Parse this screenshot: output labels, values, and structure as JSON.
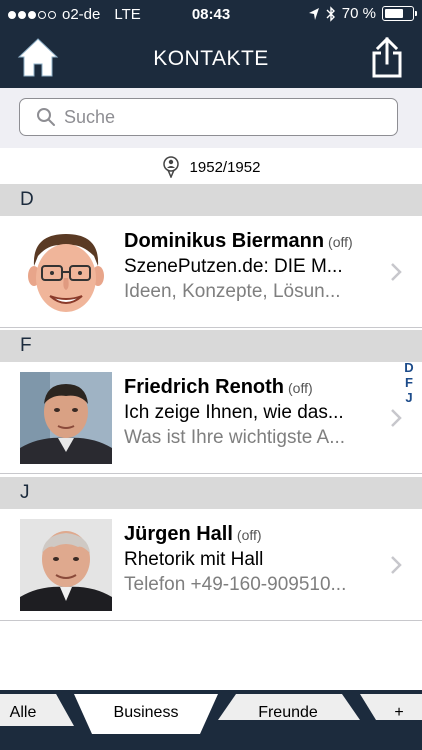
{
  "status_bar": {
    "carrier": "o2-de",
    "network": "LTE",
    "time": "08:43",
    "battery": "70 %",
    "battery_level": 0.7,
    "signal_bars_filled": 3,
    "signal_bars_total": 5
  },
  "nav": {
    "title": "KONTAKTE"
  },
  "search": {
    "placeholder": "Suche"
  },
  "contact_count": "1952/1952",
  "sections": [
    {
      "letter": "D",
      "contacts": [
        {
          "name": "Dominikus Biermann",
          "status": "(off)",
          "line2": "SzenePutzen.de: DIE M...",
          "line3": "Ideen, Konzepte, Lösun..."
        }
      ]
    },
    {
      "letter": "F",
      "contacts": [
        {
          "name": "Friedrich Renoth",
          "status": "(off)",
          "line2": "Ich zeige Ihnen, wie das...",
          "line3": "Was ist Ihre wichtigste A..."
        }
      ]
    },
    {
      "letter": "J",
      "contacts": [
        {
          "name": "Jürgen Hall",
          "status": "(off)",
          "line2": "Rhetorik mit Hall",
          "line3": "Telefon +49-160-909510..."
        }
      ]
    }
  ],
  "index": [
    "D",
    "F",
    "J"
  ],
  "tabs": [
    {
      "label": "Alle"
    },
    {
      "label": "Business",
      "active": true
    },
    {
      "label": "Freunde"
    },
    {
      "label": "+"
    }
  ],
  "colors": {
    "bar_dark": "#1c2b3d",
    "section_bg": "#d9d9d9",
    "index_blue": "#1c4b8a"
  }
}
